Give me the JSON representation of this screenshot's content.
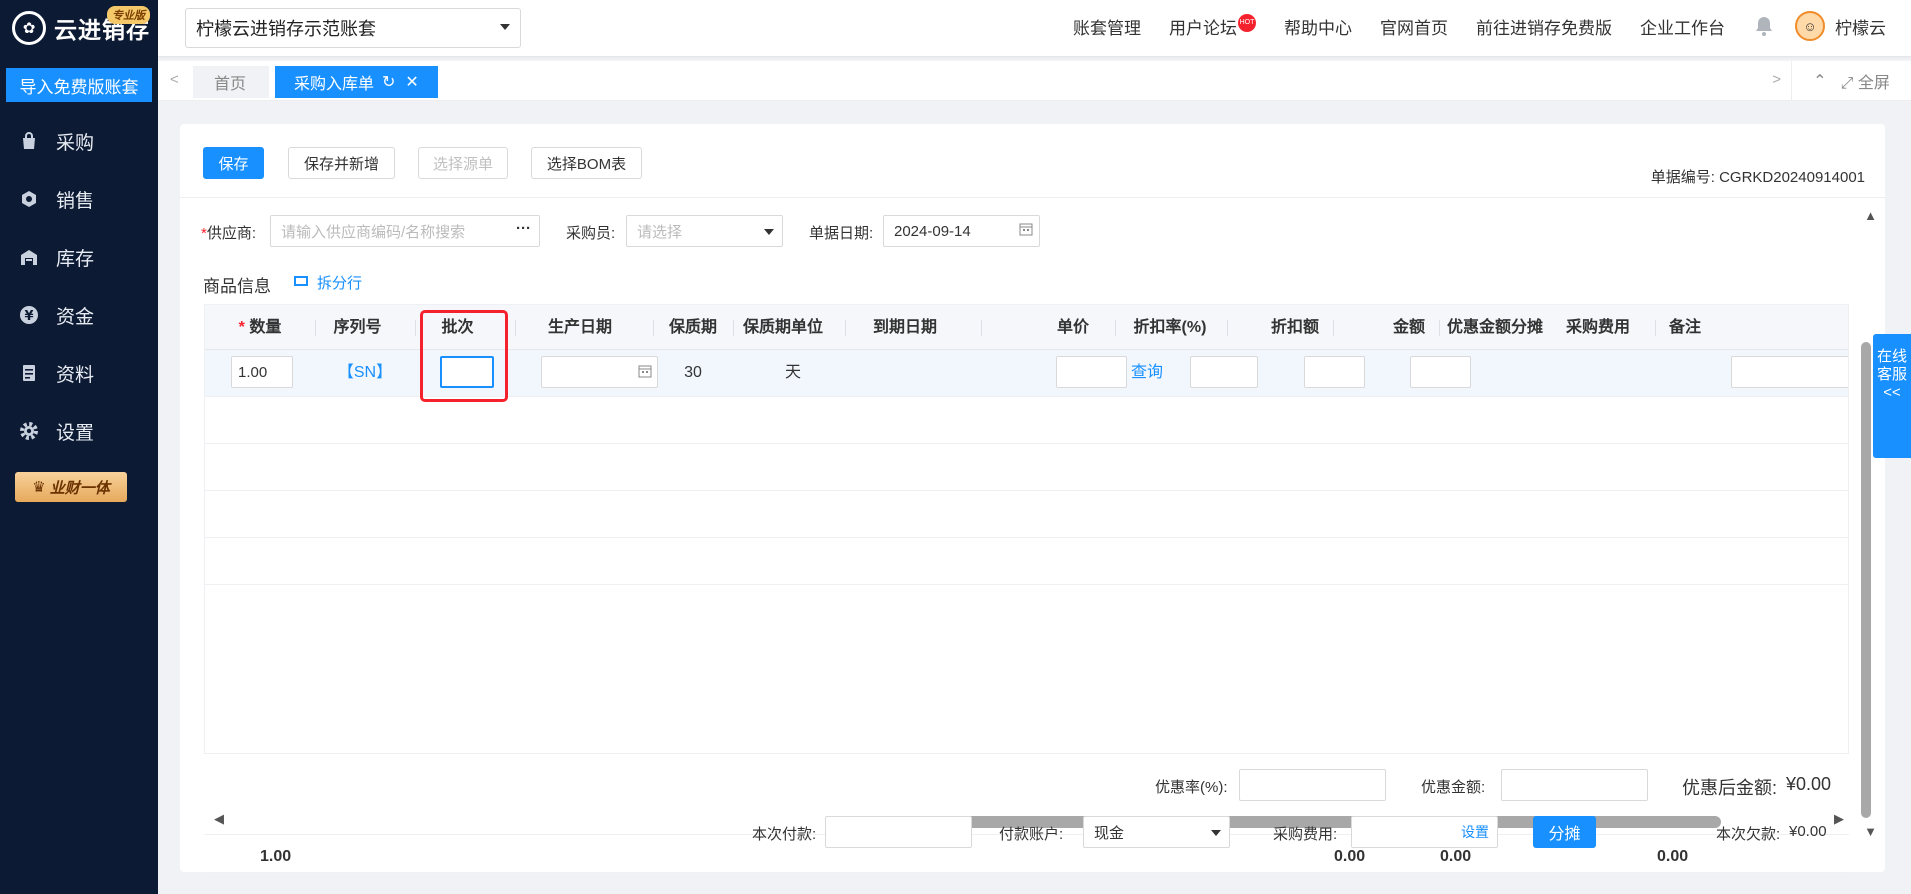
{
  "app": {
    "logo_text": "云进销存",
    "pro_badge": "专业版",
    "import_button": "导入免费版账套",
    "caiwu_button": "业财一体"
  },
  "sidebar": {
    "items": [
      {
        "label": "采购",
        "icon": "bag-icon"
      },
      {
        "label": "销售",
        "icon": "sales-icon"
      },
      {
        "label": "库存",
        "icon": "warehouse-icon"
      },
      {
        "label": "资金",
        "icon": "yen-icon"
      },
      {
        "label": "资料",
        "icon": "document-icon"
      },
      {
        "label": "设置",
        "icon": "gear-icon"
      }
    ]
  },
  "header": {
    "account_name": "柠檬云进销存示范账套",
    "links": [
      "账套管理",
      "用户论坛",
      "帮助中心",
      "官网首页",
      "前往进销存免费版",
      "企业工作台"
    ],
    "hot_badge": "HOT",
    "user_name": "柠檬云"
  },
  "tabs": {
    "home": "首页",
    "active": "采购入库单",
    "fullscreen": "全屏"
  },
  "toolbar": {
    "save": "保存",
    "save_new": "保存并新增",
    "select_source": "选择源单",
    "select_bom": "选择BOM表",
    "doc_no_label": "单据编号:",
    "doc_no": "CGRKD20240914001"
  },
  "form": {
    "supplier_label": "供应商:",
    "supplier_placeholder": "请输入供应商编码/名称搜索",
    "buyer_label": "采购员:",
    "buyer_placeholder": "请选择",
    "date_label": "单据日期:",
    "date_value": "2024-09-14"
  },
  "goods": {
    "section_title": "商品信息",
    "split_row": "拆分行",
    "columns": [
      "数量",
      "序列号",
      "批次",
      "生产日期",
      "保质期",
      "保质期单位",
      "到期日期",
      "单价",
      "折扣率(%)",
      "折扣额",
      "金额",
      "优惠金额分摊",
      "采购费用",
      "备注"
    ],
    "row": {
      "qty": "1.00",
      "sn": "【SN】",
      "shelf_life": "30",
      "shelf_unit": "天",
      "query": "查询"
    },
    "totals": {
      "qty": "1.00",
      "discount": "0.00",
      "amount": "0.00",
      "purchase_fee": "0.00"
    }
  },
  "footer": {
    "discount_rate_label": "优惠率(%):",
    "discount_amount_label": "优惠金额:",
    "after_discount_label": "优惠后金额:",
    "after_discount_value": "¥0.00",
    "payment_label": "本次付款:",
    "account_label": "付款账户:",
    "account_value": "现金",
    "fee_label": "采购费用:",
    "fee_link": "设置",
    "allocate_button": "分摊",
    "debt_label": "本次欠款:",
    "debt_value": "¥0.00"
  },
  "service_widget": "在线客服<<"
}
